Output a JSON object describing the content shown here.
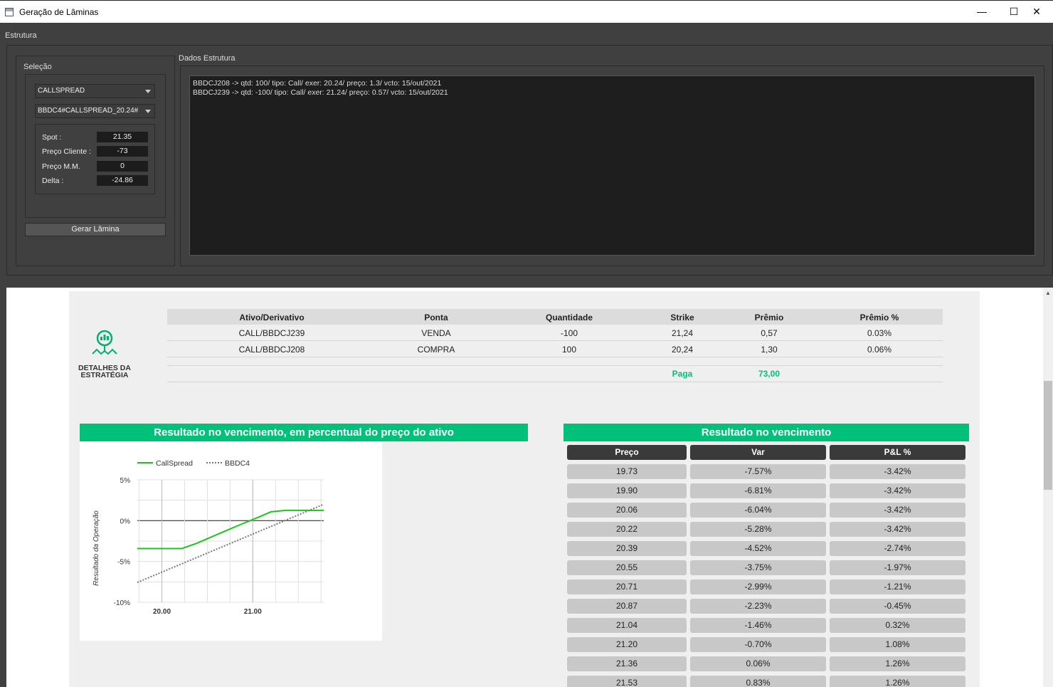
{
  "window": {
    "title": "Geração de Lâminas",
    "minimize": "—",
    "maximize": "☐",
    "close": "✕"
  },
  "menu": {
    "estrutura": "Estrutura"
  },
  "selecao": {
    "label": "Seleção",
    "strategy_combo": "CALLSPREAD",
    "structure_combo": "BBDC4#CALLSPREAD_20.24#",
    "fields": [
      {
        "label": "Spot :",
        "value": "21.35"
      },
      {
        "label": "Preço Cliente :",
        "value": "-73"
      },
      {
        "label": "Preço M.M.",
        "value": "0"
      },
      {
        "label": "Delta :",
        "value": "-24.86"
      }
    ],
    "gerar_button": "Gerar Lâmina"
  },
  "dados": {
    "label": "Dados Estrutura",
    "lines": [
      "BBDCJ208 -> qtd: 100/ tipo: Call/ exer: 20.24/ preço: 1.3/ vcto: 15/out/2021",
      "BBDCJ239 -> qtd: -100/ tipo: Call/ exer: 21.24/ preço: 0.57/ vcto: 15/out/2021"
    ]
  },
  "report": {
    "detalhes_title_1": "DETALHES DA",
    "detalhes_title_2": "ESTRATÉGIA",
    "table": {
      "headers": [
        "Ativo/Derivativo",
        "Ponta",
        "Quantidade",
        "Strike",
        "Prêmio",
        "Prêmio %"
      ],
      "rows": [
        [
          "CALL/BBDCJ239",
          "VENDA",
          "-100",
          "21,24",
          "0,57",
          "0.03%"
        ],
        [
          "CALL/BBDCJ208",
          "COMPRA",
          "100",
          "20,24",
          "1,30",
          "0.06%"
        ]
      ],
      "total_label": "Paga",
      "total_value": "73,00"
    },
    "chart_title": "Resultado no vencimento, em percentual do preço do ativo",
    "payoff_title": "Resultado no vencimento",
    "payoff_headers": [
      "Preço",
      "Var",
      "P&L %"
    ],
    "payoff_rows": [
      [
        "19.73",
        "-7.57%",
        "-3.42%"
      ],
      [
        "19.90",
        "-6.81%",
        "-3.42%"
      ],
      [
        "20.06",
        "-6.04%",
        "-3.42%"
      ],
      [
        "20.22",
        "-5.28%",
        "-3.42%"
      ],
      [
        "20.39",
        "-4.52%",
        "-2.74%"
      ],
      [
        "20.55",
        "-3.75%",
        "-1.97%"
      ],
      [
        "20.71",
        "-2.99%",
        "-1.21%"
      ],
      [
        "20.87",
        "-2.23%",
        "-0.45%"
      ],
      [
        "21.04",
        "-1.46%",
        "0.32%"
      ],
      [
        "21.20",
        "-0.70%",
        "1.08%"
      ],
      [
        "21.36",
        "0.06%",
        "1.26%"
      ],
      [
        "21.53",
        "0.83%",
        "1.26%"
      ]
    ]
  },
  "colors": {
    "accent_green": "#00c07a",
    "line_green": "#1ec41e",
    "dark_bg": "#404040"
  },
  "chart_data": {
    "type": "line",
    "title": "",
    "xlabel": "",
    "ylabel": "Resultado da Operação",
    "xlim": [
      19.73,
      21.78
    ],
    "ylim": [
      -10,
      5
    ],
    "xticks": [
      "20.00",
      "21.00"
    ],
    "xtick_values": [
      20.0,
      21.0
    ],
    "yticks": [
      "5%",
      "0%",
      "-5%",
      "-10%"
    ],
    "ytick_values": [
      5,
      0,
      -5,
      -10
    ],
    "legend": "top-left",
    "grid": true,
    "series": [
      {
        "name": "CallSpread",
        "style": "solid",
        "color": "#1ec41e",
        "x": [
          19.73,
          19.9,
          20.06,
          20.22,
          20.39,
          20.55,
          20.71,
          20.87,
          21.04,
          21.2,
          21.36,
          21.53,
          21.78
        ],
        "y": [
          -3.42,
          -3.42,
          -3.42,
          -3.42,
          -2.74,
          -1.97,
          -1.21,
          -0.45,
          0.32,
          1.08,
          1.26,
          1.26,
          1.26
        ]
      },
      {
        "name": "BBDC4",
        "style": "dotted",
        "color": "#777777",
        "x": [
          19.73,
          21.78
        ],
        "y": [
          -7.57,
          2.0
        ]
      }
    ]
  }
}
